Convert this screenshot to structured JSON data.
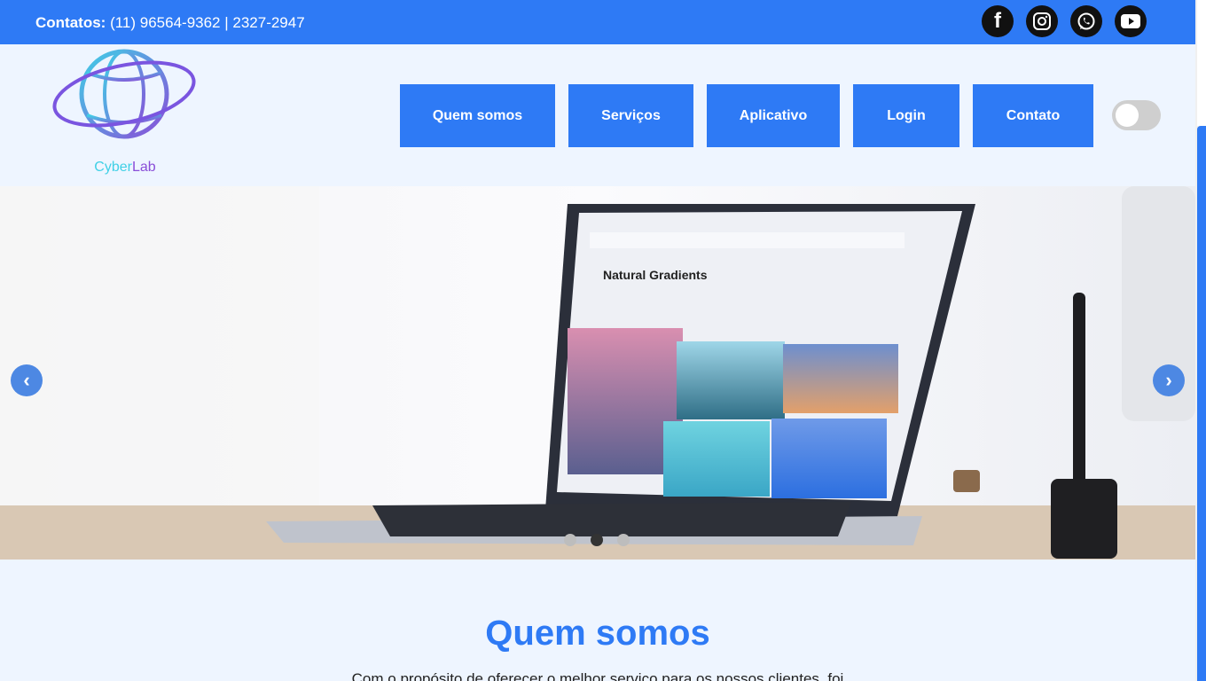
{
  "topbar": {
    "contacts_label": "Contatos:",
    "contacts_value": "(11) 96564-9362 | 2327-2947",
    "socials": [
      {
        "name": "facebook-icon",
        "glyph": "f"
      },
      {
        "name": "instagram-icon",
        "glyph": "◎"
      },
      {
        "name": "whatsapp-icon",
        "glyph": "✆"
      },
      {
        "name": "youtube-icon",
        "glyph": "▶"
      }
    ]
  },
  "logo": {
    "part1": "Cyber",
    "part2": "Lab"
  },
  "nav": {
    "items": [
      "Quem somos",
      "Serviços",
      "Aplicativo",
      "Login",
      "Contato"
    ]
  },
  "carousel": {
    "screen_title": "Natural Gradients",
    "prev_glyph": "‹",
    "next_glyph": "›",
    "slide_count": 3,
    "active_slide": 2
  },
  "section": {
    "title": "Quem somos",
    "text": "Com o propósito de oferecer o melhor serviço para os nossos clientes, foi"
  },
  "colors": {
    "primary": "#2e7af5",
    "logo_cyan": "#3fd0e6",
    "logo_purple": "#8a4ed8"
  }
}
